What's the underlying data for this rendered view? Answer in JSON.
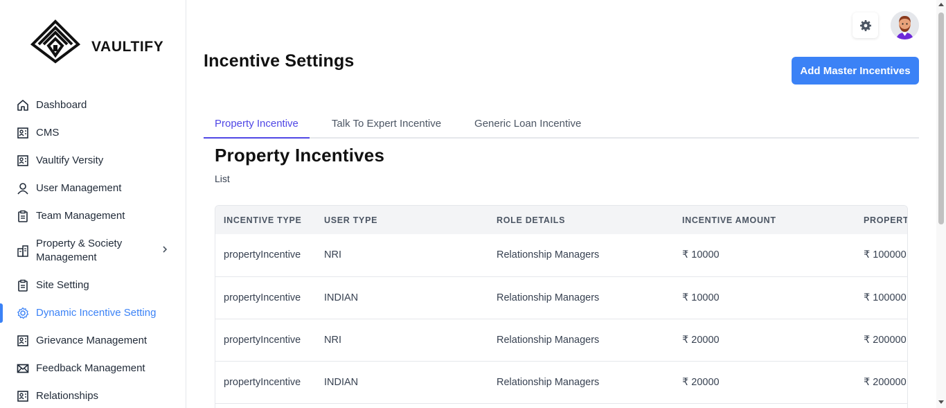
{
  "brand": {
    "name": "VAULTIFY"
  },
  "sidebar": {
    "items": [
      {
        "label": "Dashboard",
        "icon": "home-icon"
      },
      {
        "label": "CMS",
        "icon": "id-card-icon"
      },
      {
        "label": "Vaultify Versity",
        "icon": "id-card-icon"
      },
      {
        "label": "User Management",
        "icon": "user-icon"
      },
      {
        "label": "Team Management",
        "icon": "clipboard-icon"
      },
      {
        "label": "Property & Society Management",
        "icon": "building-icon"
      },
      {
        "label": "Site Setting",
        "icon": "clipboard-icon"
      },
      {
        "label": "Dynamic Incentive Setting",
        "icon": "gear-icon"
      },
      {
        "label": "Grievance Management",
        "icon": "id-card-icon"
      },
      {
        "label": "Feedback Management",
        "icon": "mail-icon"
      },
      {
        "label": "Relationships",
        "icon": "id-card-icon"
      }
    ],
    "active_index": 7
  },
  "header": {
    "page_title": "Incentive Settings",
    "primary_button": "Add Master Incentives"
  },
  "tabs": [
    {
      "label": "Property Incentive",
      "active": true
    },
    {
      "label": "Talk To Expert Incentive",
      "active": false
    },
    {
      "label": "Generic Loan Incentive",
      "active": false
    }
  ],
  "section": {
    "title": "Property Incentives",
    "subtitle": "List"
  },
  "table": {
    "columns": [
      "INCENTIVE TYPE",
      "USER TYPE",
      "ROLE DETAILS",
      "INCENTIVE AMOUNT",
      "PROPERTY"
    ],
    "rows": [
      [
        "propertyIncentive",
        "NRI",
        "Relationship Managers",
        "₹ 10000",
        "₹ 100000"
      ],
      [
        "propertyIncentive",
        "INDIAN",
        "Relationship Managers",
        "₹ 10000",
        "₹ 100000"
      ],
      [
        "propertyIncentive",
        "NRI",
        "Relationship Managers",
        "₹ 20000",
        "₹ 200000"
      ],
      [
        "propertyIncentive",
        "INDIAN",
        "Relationship Managers",
        "₹ 20000",
        "₹ 200000"
      ]
    ]
  },
  "colors": {
    "accent": "#3b82f6",
    "tab_active": "#4f46e5",
    "table_header_bg": "#f3f4f6"
  }
}
